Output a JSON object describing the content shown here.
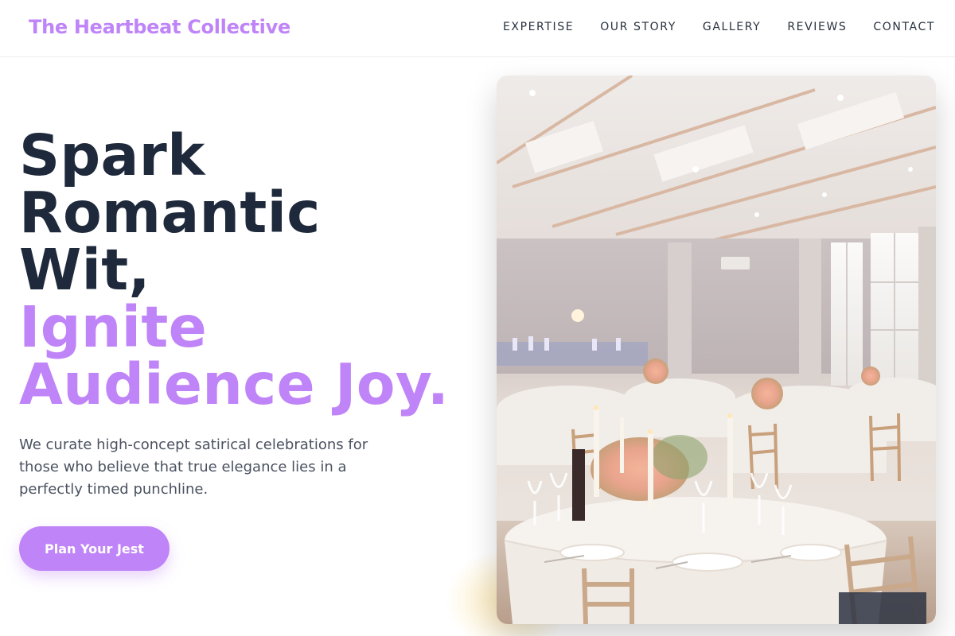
{
  "header": {
    "brand": "The Heartbeat Collective",
    "nav": [
      "EXPERTISE",
      "OUR STORY",
      "GALLERY",
      "REVIEWS",
      "CONTACT"
    ]
  },
  "hero": {
    "title_lines": [
      "Spark",
      "Romantic",
      "Wit,"
    ],
    "accent_lines": [
      "Ignite",
      "Audience Joy."
    ],
    "subtitle": "We curate high-concept satirical celebrations for those who believe that true elegance lies in a perfectly timed punchline.",
    "cta_label": "Plan Your Jest"
  },
  "image": {
    "subject": "banquet-hall-wedding-reception-photo"
  },
  "colors": {
    "accent": "#bf84f7",
    "heading": "#1e293b",
    "body": "#4a5260"
  }
}
